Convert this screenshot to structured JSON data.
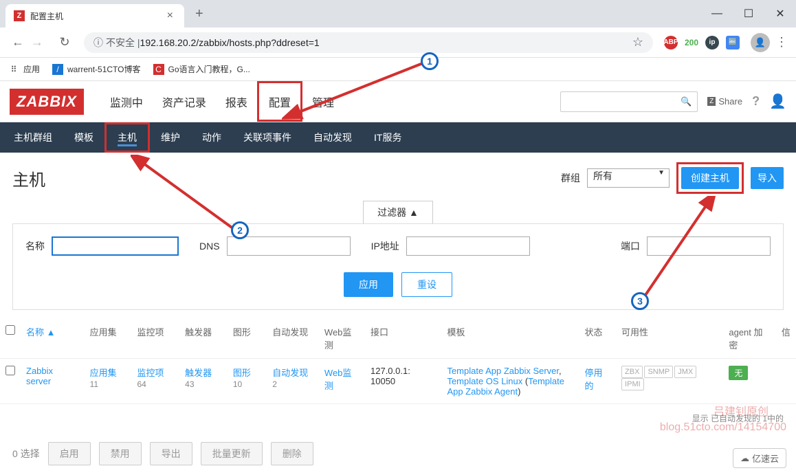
{
  "browser": {
    "tab_title": "配置主机",
    "address_prefix": "不安全 | ",
    "url": "192.168.20.2/zabbix/hosts.php?ddreset=1",
    "bookmarks": {
      "apps": "应用",
      "bm1": "warrent-51CTO博客",
      "bm2": "Go语言入门教程，G..."
    },
    "ext_green": "200"
  },
  "zabbix": {
    "logo": "ZABBIX",
    "nav": [
      "监测中",
      "资产记录",
      "报表",
      "配置",
      "管理"
    ],
    "share": "Share",
    "subnav": [
      "主机群组",
      "模板",
      "主机",
      "维护",
      "动作",
      "关联项事件",
      "自动发现",
      "IT服务"
    ]
  },
  "page": {
    "title": "主机",
    "group_label": "群组",
    "group_value": "所有",
    "create_btn": "创建主机",
    "import_btn": "导入"
  },
  "filter": {
    "tab": "过滤器 ▲",
    "name_label": "名称",
    "dns_label": "DNS",
    "ip_label": "IP地址",
    "port_label": "端口",
    "apply": "应用",
    "reset": "重设"
  },
  "table": {
    "headers": {
      "name": "名称 ▲",
      "apps": "应用集",
      "items": "监控项",
      "triggers": "触发器",
      "graphs": "图形",
      "discovery": "自动发现",
      "web": "Web监测",
      "interface": "接口",
      "templates": "模板",
      "status": "状态",
      "availability": "可用性",
      "agent": "agent 加密",
      "info": "信"
    },
    "row": {
      "name": "Zabbix server",
      "apps_label": "应用集",
      "apps_count": "11",
      "items_label": "监控项",
      "items_count": "64",
      "triggers_label": "触发器",
      "triggers_count": "43",
      "graphs_label": "图形",
      "graphs_count": "10",
      "discovery_label": "自动发现",
      "discovery_count": "2",
      "web_label": "Web监测",
      "interface": "127.0.0.1: 10050",
      "templates_text1": "Template App Zabbix Server",
      "templates_text2": "Template OS Linux",
      "templates_text3": "Template App Zabbix Agent",
      "status": "停用的",
      "avail": [
        "ZBX",
        "SNMP",
        "JMX",
        "IPMI"
      ],
      "enc": "无"
    },
    "footer": "显示 已自动发现的 1中的"
  },
  "bulk": {
    "selected": "0 选择",
    "enable": "启用",
    "disable": "禁用",
    "export": "导出",
    "massupdate": "批量更新",
    "delete": "删除"
  },
  "watermark": {
    "line1": "吕建钊原创",
    "line2": "blog.51cto.com/14154700",
    "yisu": "亿速云"
  }
}
